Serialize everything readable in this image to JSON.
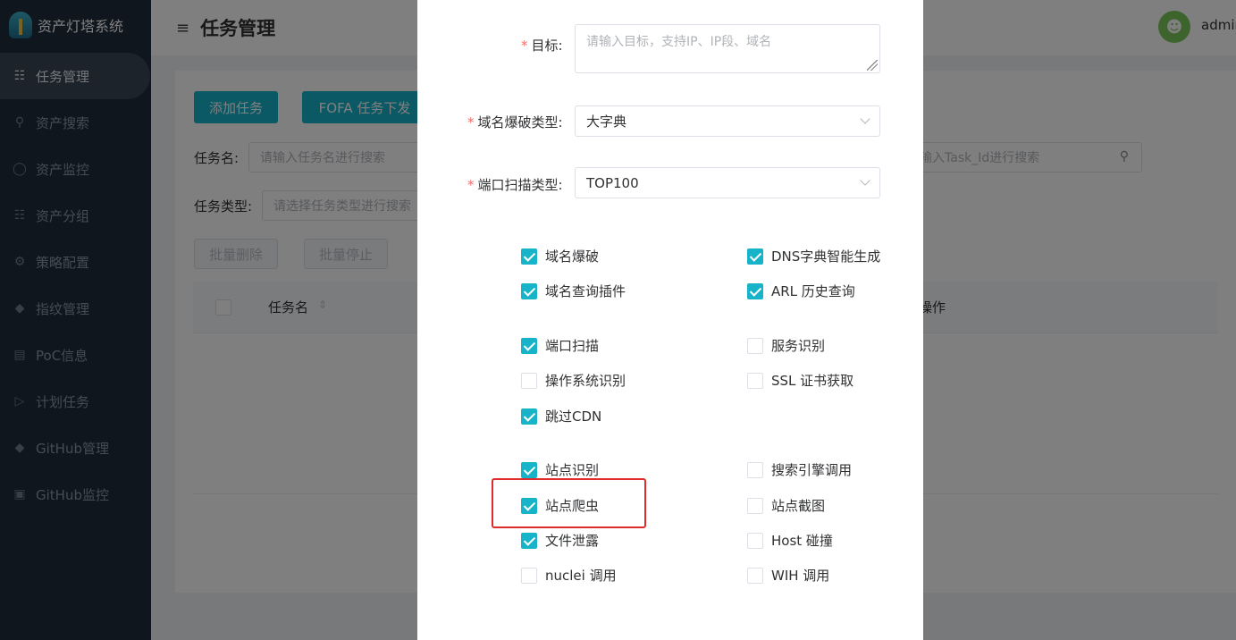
{
  "app": {
    "name": "资产灯塔系统",
    "user": "admin",
    "accent": "#17b3c9"
  },
  "sidebar": {
    "items": [
      {
        "label": "任务管理",
        "icon": "clipboard-icon",
        "active": true
      },
      {
        "label": "资产搜索",
        "icon": "search-icon"
      },
      {
        "label": "资产监控",
        "icon": "shield-icon"
      },
      {
        "label": "资产分组",
        "icon": "tree-icon"
      },
      {
        "label": "策略配置",
        "icon": "gear-icon"
      },
      {
        "label": "指纹管理",
        "icon": "tag-icon"
      },
      {
        "label": "PoC信息",
        "icon": "document-icon"
      },
      {
        "label": "计划任务",
        "icon": "terminal-icon"
      },
      {
        "label": "GitHub管理",
        "icon": "diamond-icon"
      },
      {
        "label": "GitHub监控",
        "icon": "monitor-icon"
      }
    ]
  },
  "header": {
    "title": "任务管理"
  },
  "main": {
    "add_task": "添加任务",
    "fofa_task": "FOFA 任务下发",
    "task_name_label": "任务名:",
    "task_name_placeholder": "请输入任务名进行搜索",
    "task_id_placeholder": "输入Task_Id进行搜索",
    "task_type_label": "任务类型:",
    "task_type_placeholder": "请选择任务类型进行搜索",
    "batch_delete": "批量删除",
    "batch_stop": "批量停止",
    "col_task_name": "任务名",
    "col_actions": "操作"
  },
  "dialog": {
    "target_label": "目标:",
    "target_placeholder": "请输入目标，支持IP、IP段、域名",
    "domain_brute_type_label": "域名爆破类型:",
    "domain_brute_type_value": "大字典",
    "port_scan_type_label": "端口扫描类型:",
    "port_scan_type_value": "TOP100",
    "options": {
      "domain_brute": {
        "label": "域名爆破",
        "checked": true
      },
      "dns_dict_gen": {
        "label": "DNS字典智能生成",
        "checked": true
      },
      "domain_query_plugin": {
        "label": "域名查询插件",
        "checked": true
      },
      "arl_history": {
        "label": "ARL 历史查询",
        "checked": true
      },
      "port_scan": {
        "label": "端口扫描",
        "checked": true
      },
      "service_detect": {
        "label": "服务识别",
        "checked": false
      },
      "os_detect": {
        "label": "操作系统识别",
        "checked": false
      },
      "ssl_cert": {
        "label": "SSL 证书获取",
        "checked": false
      },
      "skip_cdn": {
        "label": "跳过CDN",
        "checked": true
      },
      "site_identify": {
        "label": "站点识别",
        "checked": true
      },
      "search_engine": {
        "label": "搜索引擎调用",
        "checked": false
      },
      "site_crawler": {
        "label": "站点爬虫",
        "checked": true
      },
      "site_screenshot": {
        "label": "站点截图",
        "checked": false
      },
      "file_leak": {
        "label": "文件泄露",
        "checked": true
      },
      "host_collision": {
        "label": "Host 碰撞",
        "checked": false
      },
      "nuclei": {
        "label": "nuclei 调用",
        "checked": false
      },
      "wih": {
        "label": "WIH 调用",
        "checked": false
      }
    }
  }
}
